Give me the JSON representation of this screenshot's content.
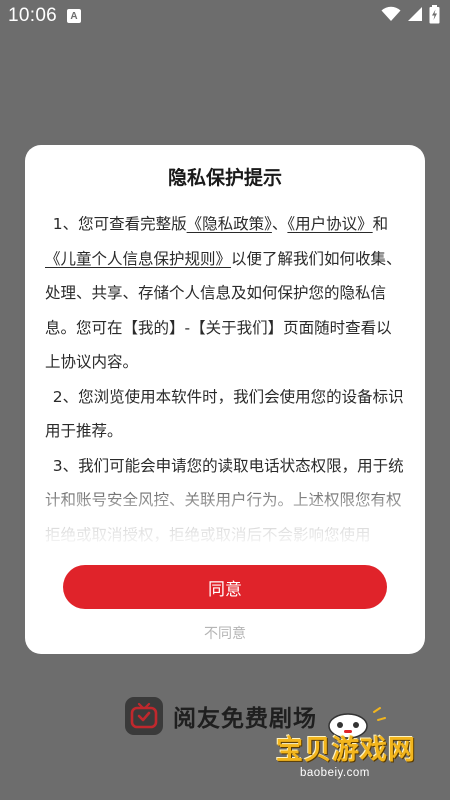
{
  "status_bar": {
    "time": "10:06",
    "notification_glyph": "A",
    "icons": [
      "wifi-icon",
      "signal-icon",
      "battery-icon"
    ]
  },
  "dialog": {
    "title": "隐私保护提示",
    "para1": {
      "part1": "1、您可查看完整版",
      "link_privacy": "《隐私政策》",
      "sep": "、",
      "link_user": "《用户协议》",
      "and": "和",
      "link_children": "《儿童个人信息保护规则》",
      "rest": "以便了解我们如何收集、处理、共享、存储个人信息及如何保护您的隐私信息。您可在【我的】-【关于我们】页面随时查看以上协议内容。"
    },
    "para2": "2、您浏览使用本软件时，我们会使用您的设备标识用于推荐。",
    "para3": "3、我们可能会申请您的读取电话状态权限，用于统计和账号安全风控、关联用户行为。上述权限您有权拒绝或取消授权，拒绝或取消后不会影响您使用",
    "agree_label": "同意",
    "disagree_label": "不同意"
  },
  "app_brand": {
    "name": "阅友免费剧场",
    "logo_icon": "tv-play-logo-icon"
  },
  "watermark": {
    "text": "宝贝游戏网",
    "url": "baobeiy.com"
  },
  "colors": {
    "overlay": "#6d6d6d",
    "accent": "#e0232a",
    "disagree_text": "#b5b5b5"
  }
}
